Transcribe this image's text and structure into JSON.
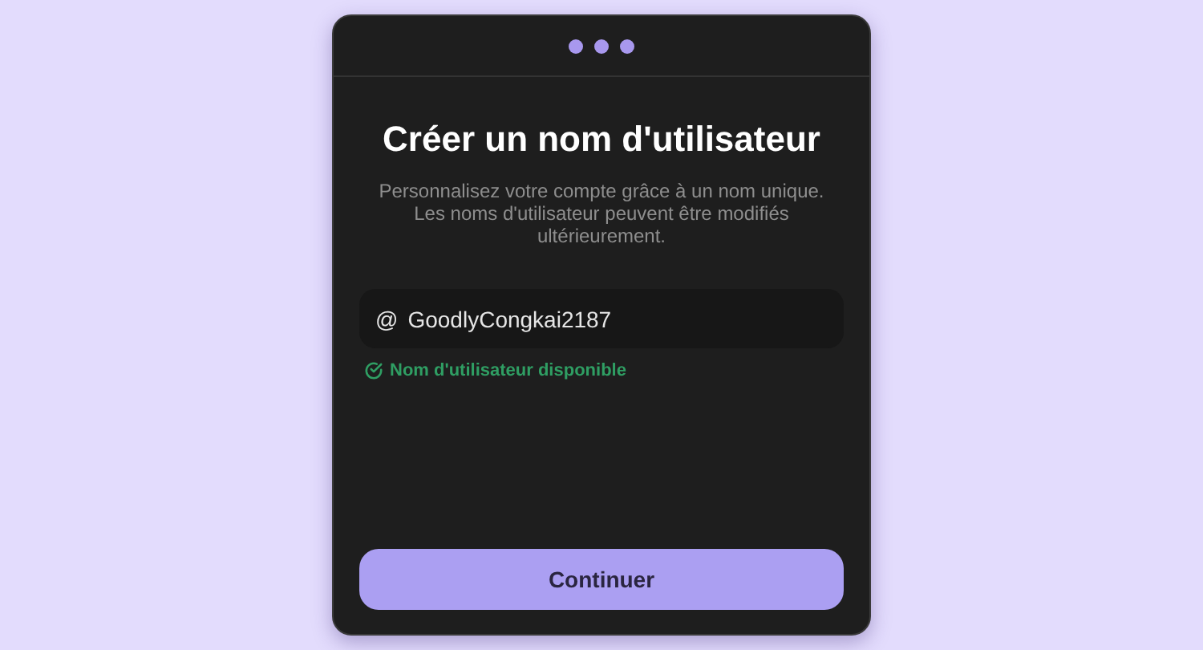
{
  "title": "Créer un nom d'utilisateur",
  "subtitle": "Personnalisez votre compte grâce à un nom unique. Les noms d'utilisateur peuvent être modifiés ultérieurement.",
  "username_field": {
    "prefix": "@",
    "value": "GoodlyCongkai2187"
  },
  "status": {
    "available": true,
    "message": "Nom d'utilisateur disponible"
  },
  "buttons": [
    "Continuer"
  ]
}
